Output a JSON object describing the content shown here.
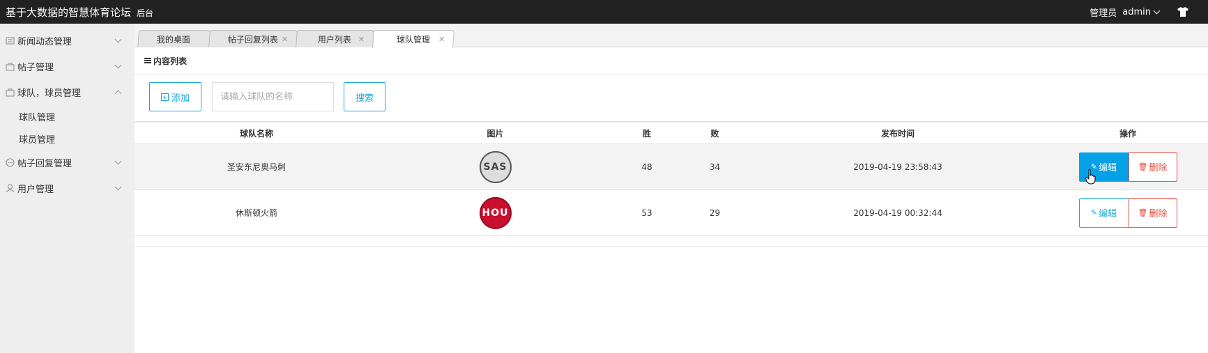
{
  "header": {
    "title": "基于大数据的智慧体育论坛",
    "subtitle": "后台",
    "role": "管理员",
    "username": "admin"
  },
  "sidebar": {
    "items": [
      {
        "label": "新闻动态管理",
        "icon": "news-icon",
        "expanded": false
      },
      {
        "label": "帖子管理",
        "icon": "bag-icon",
        "expanded": false
      },
      {
        "label": "球队，球员管理",
        "icon": "bag-icon",
        "expanded": true,
        "children": [
          "球队管理",
          "球员管理"
        ]
      },
      {
        "label": "帖子回复管理",
        "icon": "comment-icon",
        "expanded": false
      },
      {
        "label": "用户管理",
        "icon": "user-icon",
        "expanded": false
      }
    ]
  },
  "tabs": [
    {
      "label": "我的桌面",
      "active": false,
      "closable": false
    },
    {
      "label": "帖子回复列表",
      "active": false,
      "closable": true
    },
    {
      "label": "用户列表",
      "active": false,
      "closable": true
    },
    {
      "label": "球队管理",
      "active": true,
      "closable": true
    }
  ],
  "content": {
    "section_title": "内容列表",
    "add_label": "添加",
    "search_placeholder": "请输入球队的名称",
    "search_label": "搜索"
  },
  "table": {
    "columns": [
      "球队名称",
      "图片",
      "胜",
      "败",
      "发布时间",
      "操作"
    ],
    "rows": [
      {
        "name": "圣安东尼奥马刺",
        "logo": "SAS",
        "win": "48",
        "lose": "34",
        "date": "2019-04-19 23:58:43"
      },
      {
        "name": "休斯顿火箭",
        "logo": "HOU",
        "win": "53",
        "lose": "29",
        "date": "2019-04-19 00:32:44"
      }
    ],
    "edit_label": "编辑",
    "delete_label": "删除"
  },
  "colors": {
    "header_bg": "#222222",
    "accent": "#1ba8d5",
    "edit_active": "#05a1e6",
    "danger": "#e74c3c",
    "hou_red": "#c8102e"
  }
}
